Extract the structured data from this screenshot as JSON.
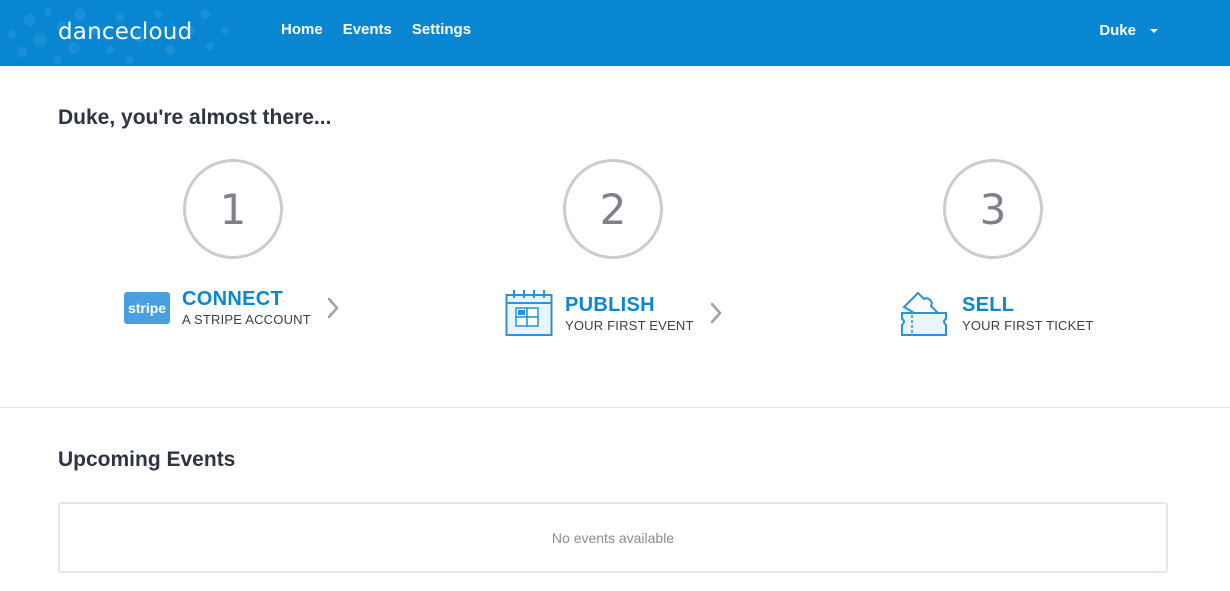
{
  "header": {
    "logo_part1": "dance",
    "logo_part2": "cloud",
    "nav": [
      {
        "label": "Home"
      },
      {
        "label": "Events"
      },
      {
        "label": "Settings"
      }
    ],
    "user_name": "Duke",
    "colors": {
      "bar": "#0886d1",
      "accent": "#0a88cf"
    }
  },
  "onboarding": {
    "heading": "Duke, you're almost there...",
    "steps": [
      {
        "number": "1",
        "title": "CONNECT",
        "subtitle": "A STRIPE ACCOUNT",
        "icon": "stripe-icon",
        "badge": "stripe"
      },
      {
        "number": "2",
        "title": "PUBLISH",
        "subtitle": "YOUR FIRST EVENT",
        "icon": "calendar-icon"
      },
      {
        "number": "3",
        "title": "SELL",
        "subtitle": "YOUR FIRST TICKET",
        "icon": "ticket-icon"
      }
    ]
  },
  "upcoming": {
    "heading": "Upcoming Events",
    "empty_text": "No events available"
  }
}
